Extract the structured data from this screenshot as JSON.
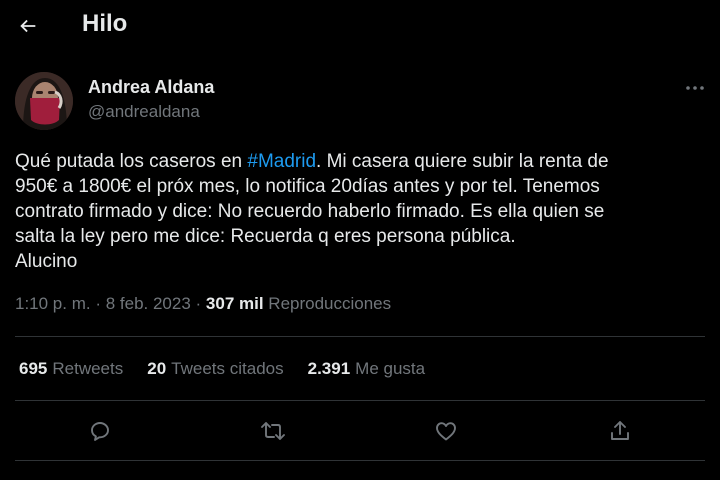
{
  "header": {
    "title": "Hilo",
    "back_icon": "arrow-left-icon"
  },
  "author": {
    "name": "Andrea Aldana",
    "handle": "@andrealdana"
  },
  "tweet": {
    "line1_before": "Qué putada los caseros en ",
    "hashtag": "#Madrid",
    "line1_after": ". Mi casera quiere subir la renta de",
    "line2": "950€ a 1800€ el próx mes, lo notifica 20días antes y por tel. Tenemos",
    "line3": "contrato firmado y dice: No recuerdo haberlo firmado. Es ella quien se",
    "line4": "salta la ley pero me dice: Recuerda q eres persona pública.",
    "line5": "Alucino"
  },
  "meta": {
    "time": "1:10 p. m.",
    "sep1": " · ",
    "date": "8 feb. 2023",
    "sep2": " · ",
    "views_count": "307 mil",
    "views_label": " Reproducciones"
  },
  "stats": {
    "retweets_count": "695",
    "retweets_label": "Retweets",
    "quotes_count": "20",
    "quotes_label": "Tweets citados",
    "likes_count": "2.391",
    "likes_label": "Me gusta"
  },
  "actions": [
    "reply-icon",
    "retweet-icon",
    "like-icon",
    "share-icon"
  ],
  "colors": {
    "background": "#000000",
    "text": "#e7e9ea",
    "secondary": "#71767b",
    "accent": "#1d9bf0",
    "divider": "#2f3336"
  }
}
